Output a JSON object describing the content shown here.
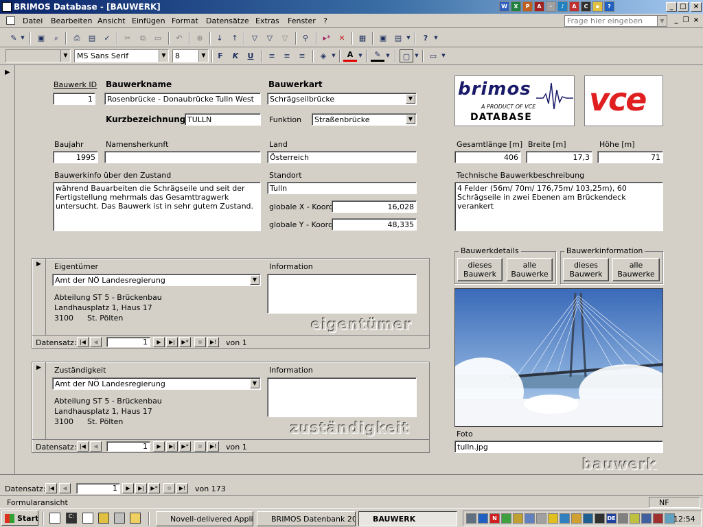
{
  "window": {
    "title": "BRIMOS Database - [BAUWERK]",
    "controls": [
      "_",
      "□",
      "×"
    ]
  },
  "menu": {
    "items": [
      "Datei",
      "Bearbeiten",
      "Ansicht",
      "Einfügen",
      "Format",
      "Datensätze",
      "Extras",
      "Fenster",
      "?"
    ],
    "help_placeholder": "Frage hier eingeben"
  },
  "format_toolbar": {
    "object_combo": "",
    "font": "MS Sans Serif",
    "size": "8",
    "bold": "F",
    "italic": "K",
    "underline": "U"
  },
  "form": {
    "bauwerk_id": {
      "label": "Bauwerk ID",
      "value": "1"
    },
    "bauwerkname": {
      "label": "Bauwerkname",
      "value": "Rosenbrücke - Donaubrücke Tulln West"
    },
    "bauwerkart": {
      "label": "Bauwerkart",
      "value": "Schrägseilbrücke"
    },
    "kurzbezeichnung": {
      "label": "Kurzbezeichnung",
      "value": "TULLN"
    },
    "funktion": {
      "label": "Funktion",
      "value": "Straßenbrücke"
    },
    "baujahr": {
      "label": "Baujahr",
      "value": "1995"
    },
    "namensherkunft": {
      "label": "Namensherkunft",
      "value": ""
    },
    "land": {
      "label": "Land",
      "value": "Österreich"
    },
    "gesamtlaenge": {
      "label": "Gesamtlänge [m]",
      "value": "406"
    },
    "breite": {
      "label": "Breite [m]",
      "value": "17,3"
    },
    "hoehe": {
      "label": "Höhe [m]",
      "value": "71"
    },
    "bauwerkinfo": {
      "label": "Bauwerkinfo über den Zustand",
      "value": "während Bauarbeiten die Schrägseile und seit der Fertigstellung mehrmals das Gesamttragwerk untersucht. Das Bauwerk ist in sehr gutem Zustand."
    },
    "standort": {
      "label": "Standort",
      "value": "Tulln"
    },
    "x_koord": {
      "label": "globale X - Koord.",
      "value": "16,028"
    },
    "y_koord": {
      "label": "globale Y - Koord.",
      "value": "48,335"
    },
    "technische_beschreibung": {
      "label": "Technische Bauwerkbeschreibung",
      "value": "4 Felder (56m/ 70m/ 176,75m/ 103,25m), 60 Schrägseile in zwei Ebenen am Brückendeck verankert"
    },
    "foto": {
      "label": "Foto",
      "value": "tulln.jpg"
    },
    "watermark": "bauwerk"
  },
  "logos": {
    "brimos": {
      "word": "brimos",
      "sub": "A PRODUCT OF VCE",
      "bottom": "DATABASE"
    },
    "vce": "vce"
  },
  "button_groups": {
    "bauwerkdetails": {
      "title": "Bauwerkdetails",
      "this": "dieses Bauwerk",
      "all": "alle Bauwerke"
    },
    "bauwerkinformation": {
      "title": "Bauwerkinformation",
      "this": "dieses Bauwerk",
      "all": "alle Bauwerke"
    }
  },
  "subform_owner": {
    "label": "Eigentümer",
    "value": "Amt der NÖ Landesregierung",
    "address": [
      "Abteilung ST 5 - Brückenbau",
      "Landhausplatz 1, Haus 17"
    ],
    "plz": "3100",
    "city": "St. Pölten",
    "info_label": "Information",
    "info_value": "",
    "watermark": "eigentümer",
    "nav": {
      "label": "Datensatz:",
      "record": "1",
      "of": "von  1"
    }
  },
  "subform_resp": {
    "label": "Zuständigkeit",
    "value": "Amt der NÖ Landesregierung",
    "address": [
      "Abteilung ST 5 - Brückenbau",
      "Landhausplatz 1, Haus 17"
    ],
    "plz": "3100",
    "city": "St. Pölten",
    "info_label": "Information",
    "info_value": "",
    "watermark": "zuständigkeit",
    "nav": {
      "label": "Datensatz:",
      "record": "1",
      "of": "von  1"
    }
  },
  "main_nav": {
    "label": "Datensatz:",
    "record": "1",
    "of": "von  173"
  },
  "status": {
    "mode": "Formularansicht",
    "indicator": "NF"
  },
  "taskbar": {
    "start": "Start",
    "tasks": [
      "Novell-delivered Applic...",
      "BRIMOS Datenbank 20...",
      "BAUWERK"
    ],
    "clock": "12:54"
  }
}
